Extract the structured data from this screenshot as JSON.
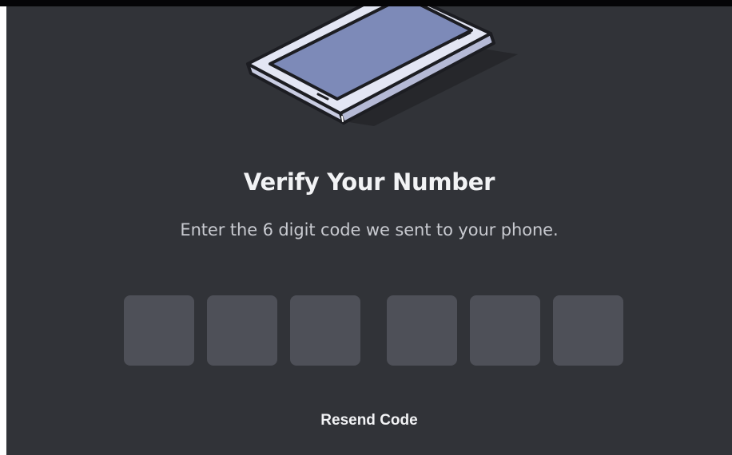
{
  "modal": {
    "title": "Verify Your Number",
    "subtitle": "Enter the 6 digit code we sent to your phone.",
    "code_inputs": [
      {
        "value": ""
      },
      {
        "value": ""
      },
      {
        "value": ""
      },
      {
        "value": ""
      },
      {
        "value": ""
      },
      {
        "value": ""
      }
    ],
    "resend_label": "Resend Code",
    "illustration_icon": "phone-icon"
  },
  "colors": {
    "background": "#313338",
    "input_fill": "#4e5058",
    "title_text": "#f2f3f5",
    "subtitle_text": "#c8cad0",
    "phone_screen": "#7d8ab8",
    "phone_body": "#e3e6f4"
  }
}
